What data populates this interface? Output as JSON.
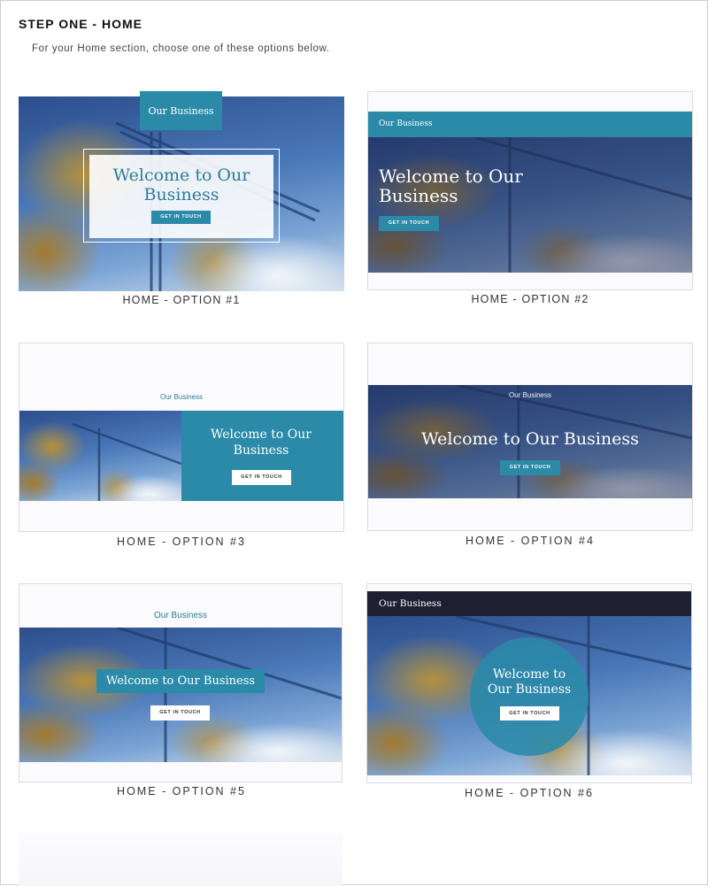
{
  "header": {
    "title": "STEP ONE - HOME",
    "description": "For your Home section, choose one of these options below."
  },
  "colors": {
    "teal": "#2a8aa8",
    "dark_bar": "#1e1f30",
    "caption_text": "#333333"
  },
  "options": [
    {
      "caption": "HOME - OPTION #1",
      "brand": "Our Business",
      "headline": "Welcome to Our Business",
      "button": "GET IN TOUCH"
    },
    {
      "caption": "HOME - OPTION #2",
      "brand": "Our Business",
      "headline": "Welcome to Our Business",
      "button": "GET IN TOUCH"
    },
    {
      "caption": "HOME - OPTION #3",
      "brand": "Our Business",
      "headline": "Welcome to Our Business",
      "button": "GET IN TOUCH"
    },
    {
      "caption": "HOME - OPTION #4",
      "brand": "Our Business",
      "headline": "Welcome to Our Business",
      "button": "GET IN TOUCH"
    },
    {
      "caption": "HOME - OPTION #5",
      "brand": "Our Business",
      "headline": "Welcome to Our Business",
      "button": "GET IN TOUCH"
    },
    {
      "caption": "HOME - OPTION #6",
      "brand": "Our Business",
      "headline": "Welcome to Our Business",
      "button": "GET IN TOUCH"
    }
  ]
}
